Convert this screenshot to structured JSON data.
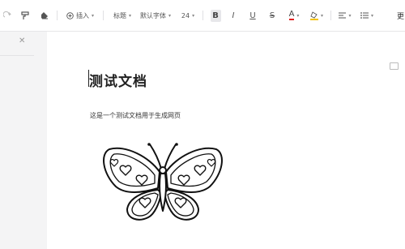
{
  "toolbar": {
    "insert_label": "插入",
    "style_label": "标题",
    "font_label": "默认字体",
    "size_label": "24",
    "bold_label": "B",
    "italic_label": "I",
    "underline_label": "U",
    "strike_label": "S",
    "font_color_label": "A",
    "font_color": "#e02020",
    "highlight_color": "#f2c200",
    "more_label": "更"
  },
  "document": {
    "title": "测试文档",
    "paragraph": "这是一个测试文档用于生成网页"
  }
}
